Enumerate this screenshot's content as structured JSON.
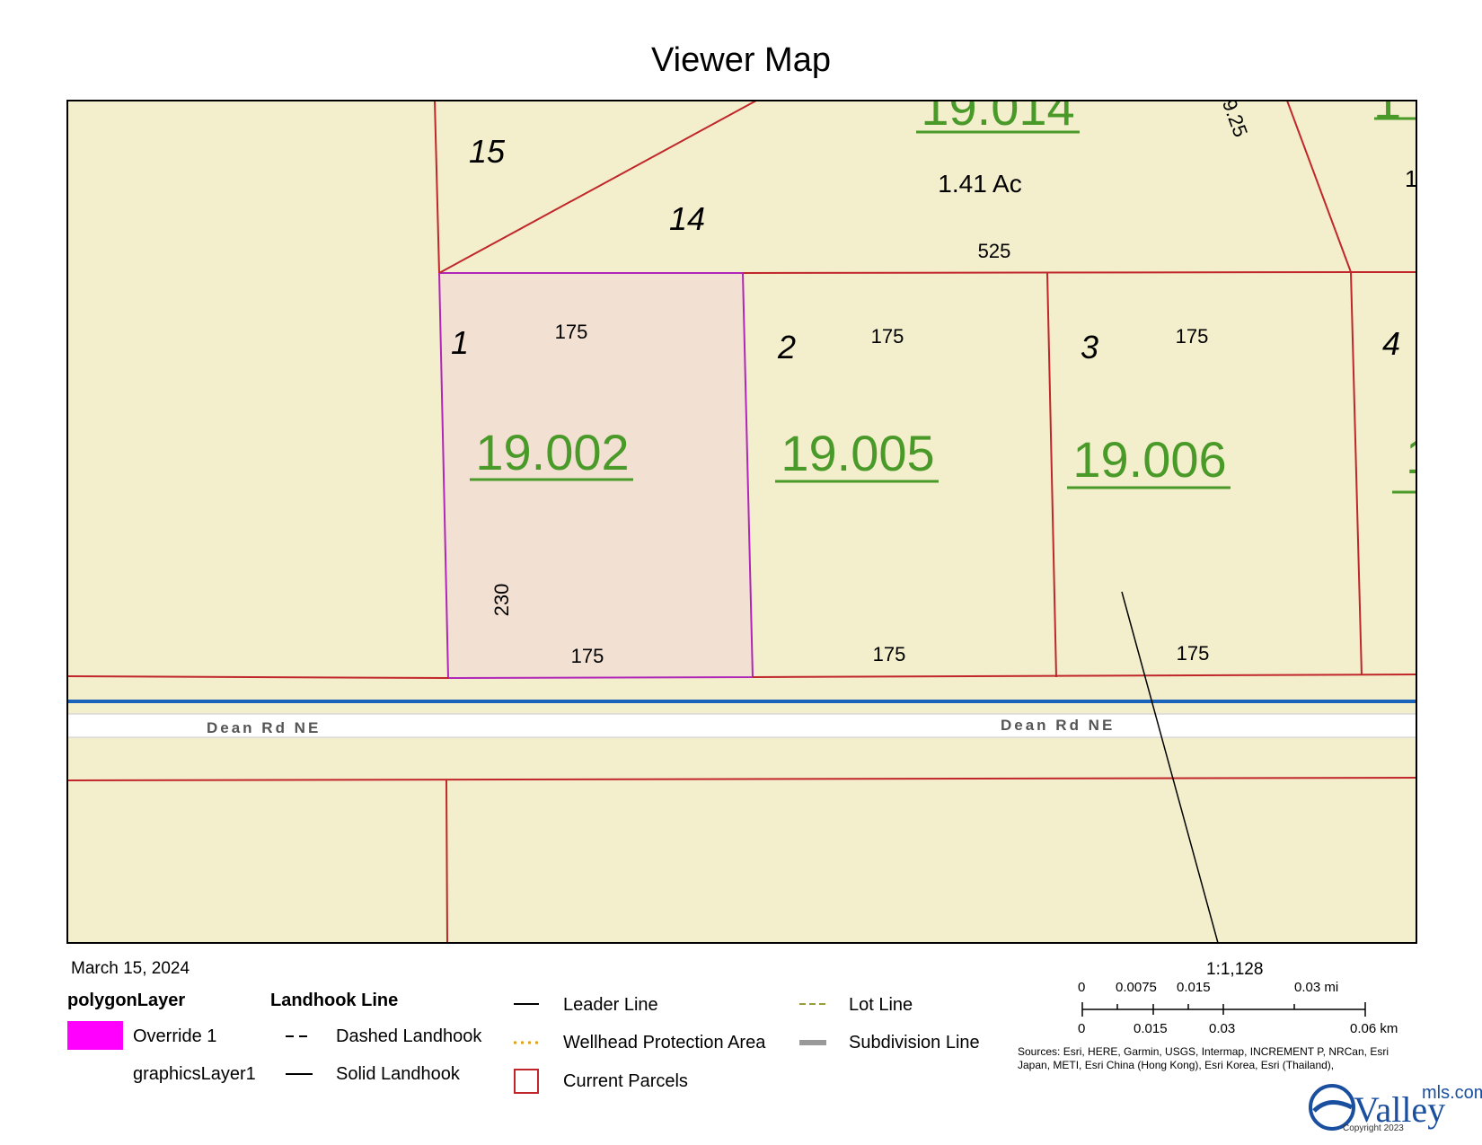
{
  "title": "Viewer Map",
  "date": "March 15, 2024",
  "map": {
    "parcel_ids": [
      "19.002",
      "19.005",
      "19.006",
      "19.014"
    ],
    "acreage": "1.41 Ac",
    "lot_numbers": [
      "15",
      "14",
      "1",
      "2",
      "3",
      "4"
    ],
    "dimensions": {
      "top_525": "525",
      "lot1_top": "175",
      "lot2_top": "175",
      "lot3_top": "175",
      "lot1_bottom": "175",
      "lot2_bottom": "175",
      "lot3_bottom": "175",
      "lot1_side": "230",
      "partial_top": "9.25",
      "partial_right": "1"
    },
    "road_label": "Dean Rd NE",
    "colors": {
      "land": "#f3eecb",
      "highlight_fill": "#f2e0d2",
      "highlight_outline": "#b026b8",
      "parcel_line": "#c0262a",
      "road_blue": "#1a63b8",
      "parcel_id_green": "#4a9a2a"
    }
  },
  "legend": {
    "polygon_layer_title": "polygonLayer",
    "override_label": "Override 1",
    "graphics_layer_label": "graphicsLayer1",
    "landhook_title": "Landhook Line",
    "dashed_landhook": "Dashed Landhook",
    "solid_landhook": "Solid Landhook",
    "leader_line": "Leader Line",
    "wellhead": "Wellhead Protection Area",
    "current_parcels": "Current Parcels",
    "lot_line": "Lot Line",
    "subdivision_line": "Subdivision Line",
    "override_color": "#ff00ff"
  },
  "scale": {
    "ratio": "1:1,128",
    "mi_ticks": [
      "0",
      "0.0075",
      "0.015",
      "0.03 mi"
    ],
    "km_ticks": [
      "0",
      "0.015",
      "0.03",
      "0.06 km"
    ]
  },
  "sources": "Sources: Esri, HERE, Garmin, USGS, Intermap, INCREMENT P, NRCan, Esri Japan, METI, Esri China (Hong Kong), Esri Korea, Esri (Thailand),",
  "logo": {
    "brand": "Valley",
    "suffix": "mls.com",
    "copyright": "Copyright 2023"
  }
}
